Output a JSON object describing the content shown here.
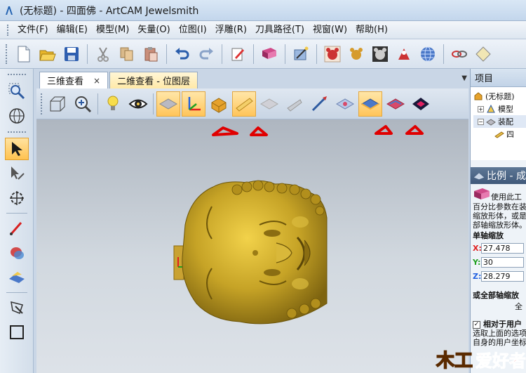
{
  "window": {
    "title": "(无标题) - 四面佛 - ArtCAM Jewelsmith",
    "app_icon": "artcam-logo-icon"
  },
  "menu": [
    "文件(F)",
    "编辑(E)",
    "模型(M)",
    "矢量(O)",
    "位图(I)",
    "浮雕(R)",
    "刀具路径(T)",
    "视窗(W)",
    "帮助(H)"
  ],
  "tabs": [
    {
      "label": "三维查看",
      "close": "×",
      "active": true
    },
    {
      "label": "二维查看 - 位图层",
      "active": false
    }
  ],
  "tabs_dropdown": "▼",
  "project_panel": {
    "title": "项目",
    "tree": [
      {
        "label": "(无标题)",
        "expander": "",
        "level": 0
      },
      {
        "label": "模型",
        "expander": "+",
        "level": 1
      },
      {
        "label": "装配",
        "expander": "−",
        "level": 1
      },
      {
        "label": "四",
        "expander": "",
        "level": 2
      }
    ]
  },
  "scale_panel": {
    "title": "比例 - 成",
    "description": [
      "使用此工",
      "百分比参数在装",
      "缩放形体，或是",
      "部轴缩放形体。"
    ],
    "single_axis": "单轴缩放",
    "x_label": "X:",
    "x_value": "27.478",
    "y_label": "Y:",
    "y_value": "30",
    "z_label": "Z:",
    "z_value": "28.279",
    "all_axis": "或全部轴缩放",
    "all_value_hint": "全",
    "relative_label": "相对于用户",
    "relative_checked": "✓",
    "note": [
      "选取上面的选项",
      "自身的用户坐标"
    ]
  },
  "watermark": {
    "text1": "木工",
    "text2": "爱好者"
  },
  "colors": {
    "highlight": "#ffc55a",
    "model_gold": "#b8961e",
    "annotation_red": "#e00000",
    "x_axis": "#e02020",
    "y_axis": "#20a020",
    "z_axis": "#2060e0"
  }
}
